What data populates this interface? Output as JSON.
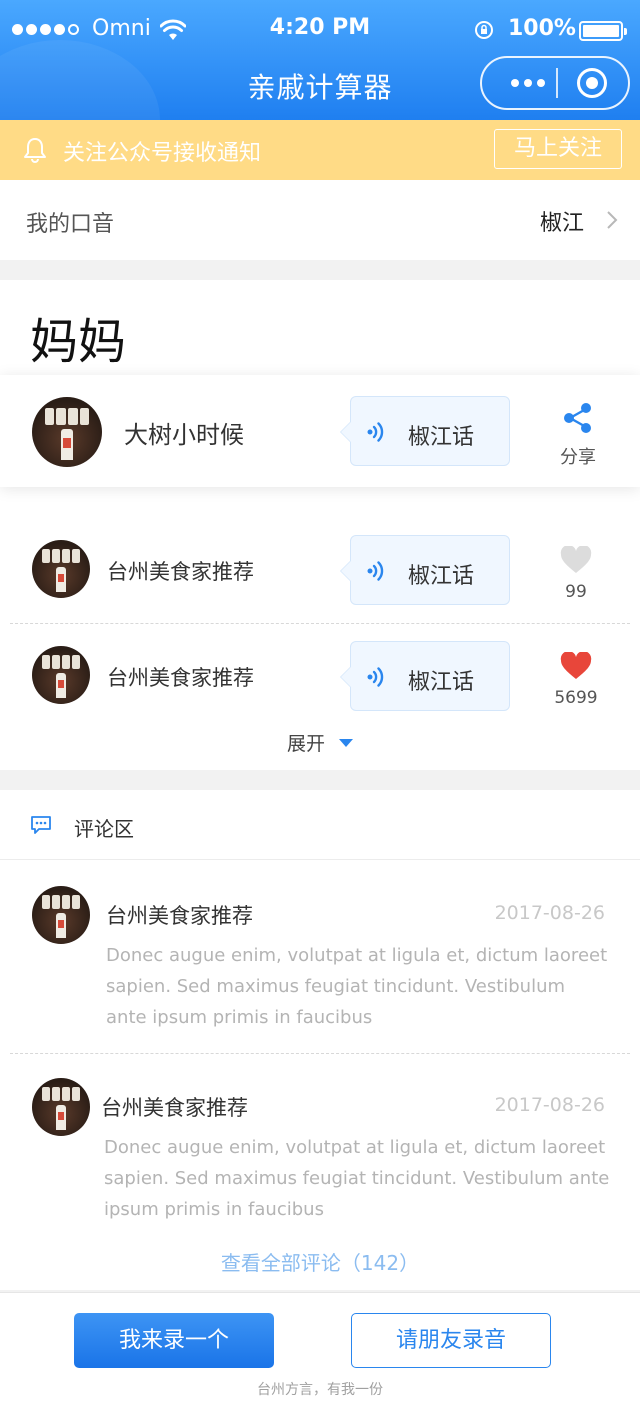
{
  "status_bar": {
    "carrier": "Omni",
    "time": "4:20 PM",
    "battery": "100%"
  },
  "nav": {
    "title": "亲戚计算器"
  },
  "notice": {
    "text": "关注公众号接收通知",
    "button": "马上关注"
  },
  "accent": {
    "label": "我的口音",
    "value": "椒江"
  },
  "word": "妈妈",
  "featured": {
    "name": "大树小时候",
    "dialect": "椒江话",
    "share_label": "分享"
  },
  "recordings": [
    {
      "name": "台州美食家推荐",
      "dialect": "椒江话",
      "likes": "99",
      "liked": false
    },
    {
      "name": "台州美食家推荐",
      "dialect": "椒江话",
      "likes": "5699",
      "liked": true
    }
  ],
  "expand_label": "展开",
  "comments": {
    "title": "评论区",
    "items": [
      {
        "name": "台州美食家推荐",
        "date": "2017-08-26",
        "text": "Donec augue enim, volutpat at ligula et, dictum laoreet sapien. Sed maximus feugiat tincidunt. Vestibulum ante ipsum primis in faucibus"
      },
      {
        "name": "台州美食家推荐",
        "date": "2017-08-26",
        "text": "Donec augue enim, volutpat at ligula et, dictum laoreet sapien. Sed maximus feugiat tincidunt. Vestibulum ante ipsum primis in faucibus"
      }
    ],
    "view_all": "查看全部评论（142）"
  },
  "footer": {
    "record_button": "我来录一个",
    "invite_button": "请朋友录音",
    "slogan": "台州方言，有我一份"
  },
  "colors": {
    "header": "#1f7ff0",
    "notice_bg": "#ffdb86",
    "accent_blue": "#2a86ee",
    "heart_liked": "#e8463a",
    "heart_unliked": "#dcdcdc"
  },
  "icons": [
    "bell-icon",
    "chevron-right-icon",
    "sound-wave-icon",
    "share-icon",
    "heart-icon",
    "comment-icon",
    "caret-down-icon",
    "more-icon",
    "close-target-icon"
  ]
}
